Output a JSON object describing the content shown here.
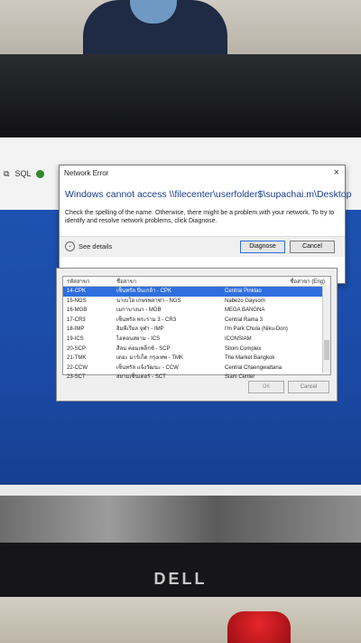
{
  "toolbar": {
    "sql_label": "SQL"
  },
  "network_error": {
    "title": "Network Error",
    "close_glyph": "×",
    "main_instruction": "Windows cannot access \\\\filecenter\\userfolder$\\supachai.m\\Desktop",
    "body_text": "Check the spelling of the name. Otherwise, there might be a problem with your network. To try to identify and resolve network problems, click Diagnose.",
    "see_details": "See details",
    "diagnose_button": "Diagnose",
    "cancel_button": "Cancel"
  },
  "branch_list": {
    "columns": [
      "รหัสสาขา",
      "ชื่อสาขา",
      "ชื่อสาขา (Eng)"
    ],
    "rows": [
      {
        "code": "14-CPK",
        "name_th": "เซ็นทรัล ปิ่นเกล้า - CPK",
        "name_en": "Central Pinklao",
        "selected": true
      },
      {
        "code": "15-NGS",
        "name_th": "นาเบโฮ เกษรพลาซ่า - NGS",
        "name_en": "Nabezo Gaysorn",
        "selected": false
      },
      {
        "code": "16-MGB",
        "name_th": "เมกาบางนา - MGB",
        "name_en": "MEGA BANGNA",
        "selected": false
      },
      {
        "code": "17-CR3",
        "name_th": "เซ็นทรัล พระราม 3 - CR3",
        "name_en": "Central Rama 3",
        "selected": false
      },
      {
        "code": "18-IMP",
        "name_th": "อิมพีเรียล จุฬา - IMP",
        "name_en": "I'm Park Chula (Niku-Don)",
        "selected": false
      },
      {
        "code": "19-ICS",
        "name_th": "ไอคอนสยาม - ICS",
        "name_en": "ICONSIAM",
        "selected": false
      },
      {
        "code": "20-SCP",
        "name_th": "สีลม คอมเพล็กซ์ - SCP",
        "name_en": "Silom Complex",
        "selected": false
      },
      {
        "code": "21-TMK",
        "name_th": "เดอะ มาร์เก็ต กรุงเทพ - TMK",
        "name_en": "The Market Bangkok",
        "selected": false
      },
      {
        "code": "22-CCW",
        "name_th": "เซ็นทรัล แจ้งวัฒนะ - CCW",
        "name_en": "Central Chaengwattana",
        "selected": false
      },
      {
        "code": "23-SCT",
        "name_th": "สยามเซ็นเตอร์ - SCT",
        "name_en": "Siam Center",
        "selected": false
      }
    ],
    "ok_button": "OK",
    "cancel_button": "Cancel"
  },
  "monitor": {
    "brand": "DELL"
  }
}
